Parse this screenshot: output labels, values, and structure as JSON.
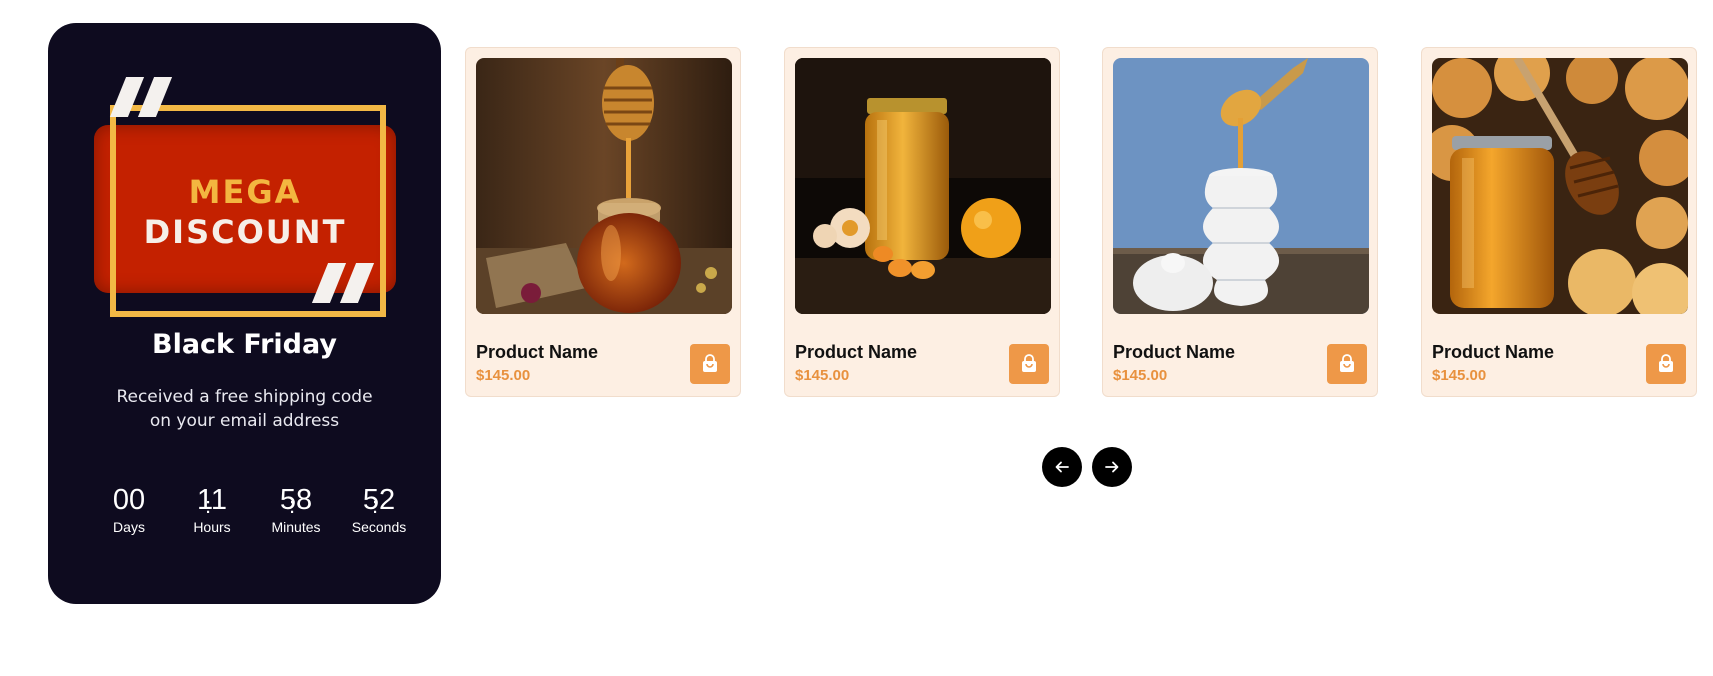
{
  "promo": {
    "badge_line1": "MEGA",
    "badge_line2": "DISCOUNT",
    "title": "Black Friday",
    "description": "Received a free shipping code on your email address",
    "countdown": [
      {
        "value": "00",
        "label": "Days"
      },
      {
        "value": "11",
        "label": "Hours"
      },
      {
        "value": "58",
        "label": "Minutes"
      },
      {
        "value": "52",
        "label": "Seconds"
      }
    ],
    "separator": ":"
  },
  "products": [
    {
      "name": "Product Name",
      "price": "$145.00",
      "image": "honey-jar-dipper"
    },
    {
      "name": "Product Name",
      "price": "$145.00",
      "image": "honey-jar-flowers"
    },
    {
      "name": "Product Name",
      "price": "$145.00",
      "image": "honey-pot-ceramic"
    },
    {
      "name": "Product Name",
      "price": "$145.00",
      "image": "honey-jar-biscuits"
    }
  ],
  "carousel": {
    "prev_icon": "arrow-left-icon",
    "next_icon": "arrow-right-icon"
  },
  "colors": {
    "promo_bg": "#0e0b1f",
    "accent": "#ee9848",
    "price": "#e8913e",
    "card_bg": "#fdefe3",
    "badge_red": "#c42100",
    "badge_gold": "#f2b845"
  }
}
